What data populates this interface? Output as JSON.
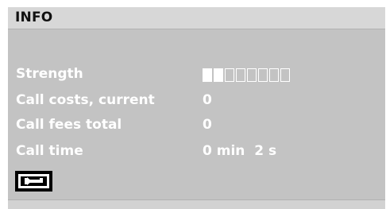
{
  "header": {
    "title": "INFO"
  },
  "rows": [
    {
      "label": "Strength",
      "value": ""
    },
    {
      "label": "Call costs, current",
      "value": "0"
    },
    {
      "label": "Call fees total",
      "value": "0"
    },
    {
      "label": "Call time",
      "value": "0 min  2 s"
    }
  ],
  "signal_strength": {
    "filled": 2,
    "total": 8
  },
  "back_button": {
    "icon": "back-arrow-icon"
  },
  "colors": {
    "panel_bg": "#c3c3c3",
    "header_bg": "#d7d7d7",
    "text": "#ffffff",
    "title_text": "#111111"
  }
}
